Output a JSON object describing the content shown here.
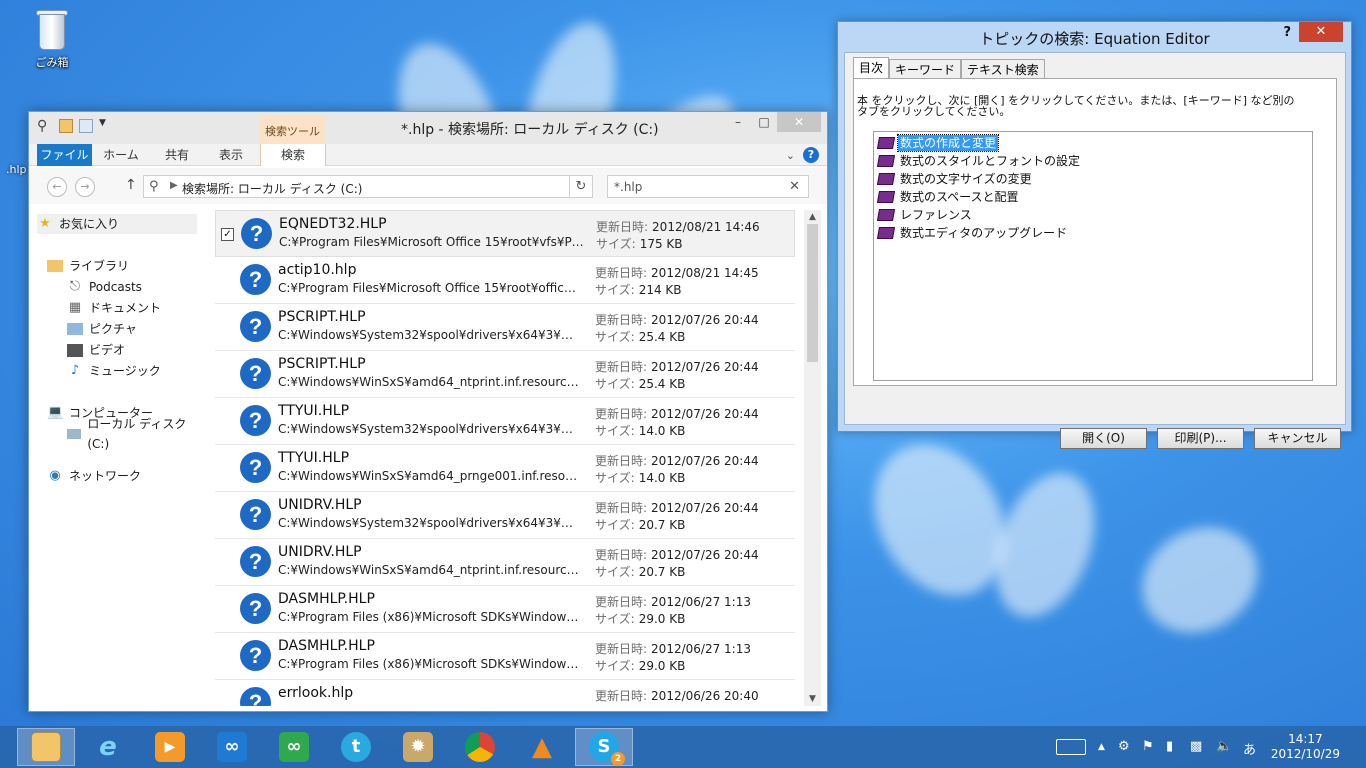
{
  "desktop": {
    "recycle_bin_label": "ごみ箱",
    "side_label": ".hlp"
  },
  "explorer": {
    "title": "*.hlp - 検索場所: ローカル ディスク (C:)",
    "context_tab_group": "検索ツール",
    "ribbon_tabs": [
      "ファイル",
      "ホーム",
      "共有",
      "表示",
      "検索"
    ],
    "address": "検索場所: ローカル ディスク (C:)",
    "search_value": "*.hlp",
    "nav": {
      "favorites": "お気に入り",
      "libraries": "ライブラリ",
      "podcasts": "Podcasts",
      "documents": "ドキュメント",
      "pictures": "ピクチャ",
      "videos": "ビデオ",
      "music": "ミュージック",
      "computer": "コンピューター",
      "local_disk": "ローカル ディスク (C:)",
      "network": "ネットワーク"
    },
    "date_label": "更新日時:",
    "size_label": "サイズ:",
    "files": [
      {
        "name": "EQNEDT32.HLP",
        "path": "C:¥Program Files¥Microsoft Office 15¥root¥vfs¥Pr...",
        "date": "2012/08/21 14:46",
        "size": "175 KB"
      },
      {
        "name": "actip10.hlp",
        "path": "C:¥Program Files¥Microsoft Office 15¥root¥office1...",
        "date": "2012/08/21 14:45",
        "size": "214 KB"
      },
      {
        "name": "PSCRIPT.HLP",
        "path": "C:¥Windows¥System32¥spool¥drivers¥x64¥3¥mu...",
        "date": "2012/07/26 20:44",
        "size": "25.4 KB"
      },
      {
        "name": "PSCRIPT.HLP",
        "path": "C:¥Windows¥WinSxS¥amd64_ntprint.inf.resource...",
        "date": "2012/07/26 20:44",
        "size": "25.4 KB"
      },
      {
        "name": "TTYUI.HLP",
        "path": "C:¥Windows¥System32¥spool¥drivers¥x64¥3¥mu...",
        "date": "2012/07/26 20:44",
        "size": "14.0 KB"
      },
      {
        "name": "TTYUI.HLP",
        "path": "C:¥Windows¥WinSxS¥amd64_prnge001.inf.resour...",
        "date": "2012/07/26 20:44",
        "size": "14.0 KB"
      },
      {
        "name": "UNIDRV.HLP",
        "path": "C:¥Windows¥System32¥spool¥drivers¥x64¥3¥mu...",
        "date": "2012/07/26 20:44",
        "size": "20.7 KB"
      },
      {
        "name": "UNIDRV.HLP",
        "path": "C:¥Windows¥WinSxS¥amd64_ntprint.inf.resource...",
        "date": "2012/07/26 20:44",
        "size": "20.7 KB"
      },
      {
        "name": "DASMHLP.HLP",
        "path": "C:¥Program Files (x86)¥Microsoft SDKs¥Windows...",
        "date": "2012/06/27 1:13",
        "size": "29.0 KB"
      },
      {
        "name": "DASMHLP.HLP",
        "path": "C:¥Program Files (x86)¥Microsoft SDKs¥Windows...",
        "date": "2012/06/27 1:13",
        "size": "29.0 KB"
      },
      {
        "name": "errlook.hlp",
        "path": "",
        "date": "2012/06/26 20:40",
        "size": ""
      }
    ]
  },
  "help": {
    "title": "トピックの検索: Equation Editor",
    "question": "?",
    "tabs": [
      "目次",
      "キーワード",
      "テキスト検索"
    ],
    "instruction": "本 をクリックし、次に [開く] をクリックしてください。または、[キーワード] など別のタブをクリックしてください。",
    "toc": [
      "数式の作成と変更",
      "数式のスタイルとフォントの設定",
      "数式の文字サイズの変更",
      "数式のスペースと配置",
      "レファレンス",
      "数式エディタのアップグレード"
    ],
    "buttons": {
      "open": "開く(O)",
      "print": "印刷(P)...",
      "cancel": "キャンセル"
    }
  },
  "taskbar": {
    "time": "14:17",
    "date": "2012/10/29",
    "ime": "あ",
    "skype_badge": "2"
  }
}
